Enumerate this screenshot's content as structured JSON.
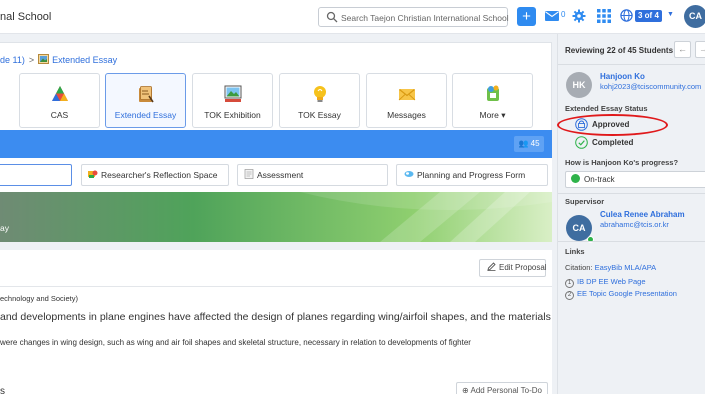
{
  "header": {
    "school_name": "nal School",
    "search_placeholder": "Search Taejon Christian International School",
    "plus_label": "+",
    "mail_count": "0",
    "school_switch_badge": "3 of 4",
    "avatar_initials": "CA"
  },
  "breadcrumb": {
    "parent": "de 11)",
    "separator": ">",
    "current": "Extended Essay"
  },
  "tiles": [
    {
      "label": "CAS"
    },
    {
      "label": "Extended Essay"
    },
    {
      "label": "TOK Exhibition"
    },
    {
      "label": "TOK Essay"
    },
    {
      "label": "Messages"
    },
    {
      "label": "More ▾"
    }
  ],
  "bluebar": {
    "count": "45"
  },
  "tabs": {
    "researcher": "Researcher's Reflection Space",
    "assessment": "Assessment",
    "planning": "Planning and Progress Form"
  },
  "banner": {
    "text": "ay"
  },
  "content": {
    "edit_label": "Edit Proposal",
    "subject": "echnology and Society)",
    "question": "and developments in plane engines have affected the design of planes regarding wing/airfoil shapes, and the materials",
    "description": "were changes in wing design, such as wing and air foil shapes and skeletal structure, necessary in relation to developments of fighter",
    "section_heading": "s",
    "todo_label": "Add Personal To-Do"
  },
  "sidebar": {
    "reviewing": "Reviewing 22 of 45 Students",
    "prev": "←",
    "next": "→",
    "student_initials": "HK",
    "student_name": "Hanjoon Ko",
    "student_email": "kohj2023@tciscommunity.com",
    "status_label": "Extended Essay Status",
    "status_approved": "Approved",
    "status_completed": "Completed",
    "progress_label": "How is Hanjoon Ko's progress?",
    "progress_value": "On-track",
    "supervisor_label": "Supervisor",
    "supervisor_initials": "CA",
    "supervisor_name": "Culea Renee Abraham",
    "supervisor_email": "abrahamc@tcis.or.kr",
    "links_label": "Links",
    "citation_prefix": "Citation:",
    "citation_link": "EasyBib MLA/APA",
    "link1_num": "1",
    "link1": "IB DP EE Web Page",
    "link2_num": "2",
    "link2": "EE Topic Google Presentation"
  },
  "colors": {
    "primary": "#3c8cf0",
    "link": "#2f6fdc",
    "success": "#2fb34a",
    "highlight_ring": "#e0191b"
  }
}
